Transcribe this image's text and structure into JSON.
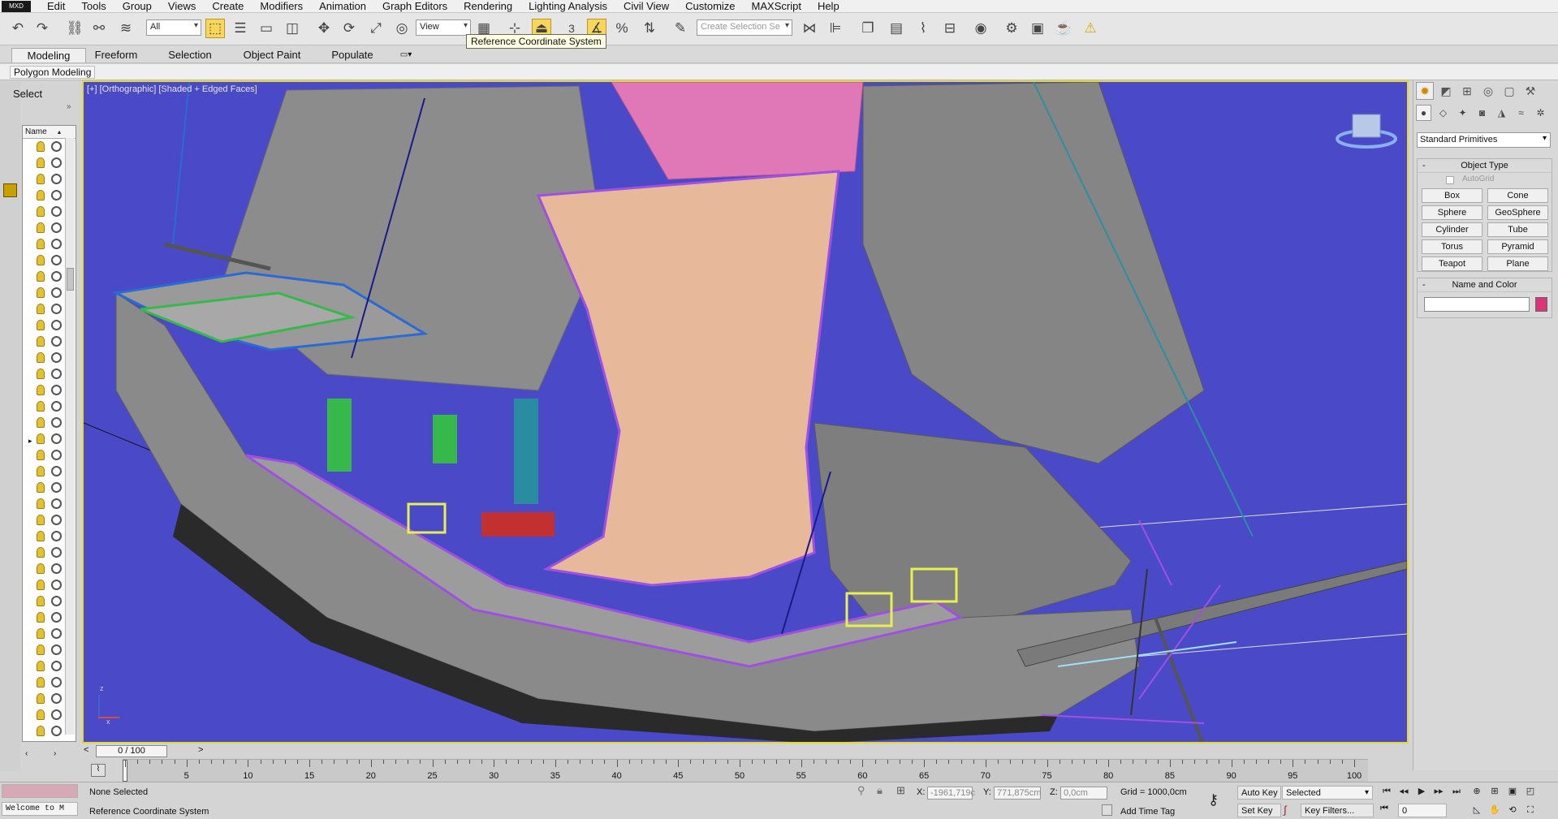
{
  "menu": [
    "Edit",
    "Tools",
    "Group",
    "Views",
    "Create",
    "Modifiers",
    "Animation",
    "Graph Editors",
    "Rendering",
    "Lighting Analysis",
    "Civil View",
    "Customize",
    "MAXScript",
    "Help"
  ],
  "app_logo": "MXD",
  "toolbar": {
    "selection_filter": "All",
    "ref_coord": "View",
    "named_selection_placeholder": "Create Selection Se",
    "snap_label": "3",
    "tooltip": "Reference Coordinate System"
  },
  "ribbon": {
    "tabs": [
      "Modeling",
      "Freeform",
      "Selection",
      "Object Paint",
      "Populate"
    ],
    "subtab": "Polygon Modeling"
  },
  "scene_explorer": {
    "select_label": "Select",
    "column_header": "Name"
  },
  "viewport": {
    "label": "[+] [Orthographic] [Shaded + Edged Faces]",
    "background_color": "#4a4ac8",
    "gizmo_axis_x": "x",
    "gizmo_axis_z": "z"
  },
  "command_panel": {
    "dropdown": "Standard Primitives",
    "object_type_title": "Object Type",
    "autogrid_label": "AutoGrid",
    "object_buttons": [
      "Box",
      "Cone",
      "Sphere",
      "GeoSphere",
      "Cylinder",
      "Tube",
      "Torus",
      "Pyramid",
      "Teapot",
      "Plane"
    ],
    "name_color_title": "Name and Color",
    "object_color": "#d9367a"
  },
  "timeline": {
    "frame_counter": "0 / 100",
    "ticks": [
      "0",
      "5",
      "10",
      "15",
      "20",
      "25",
      "30",
      "35",
      "40",
      "45",
      "50",
      "55",
      "60",
      "65",
      "70",
      "75",
      "80",
      "85",
      "90",
      "95",
      "100"
    ]
  },
  "status": {
    "selection": "None Selected",
    "prompt": "Reference Coordinate System",
    "welcome": "Welcome to M",
    "x_label": "X:",
    "x_value": "-1961,719c",
    "y_label": "Y:",
    "y_value": "771,875cm",
    "z_label": "Z:",
    "z_value": "0,0cm",
    "grid": "Grid = 1000,0cm",
    "add_time_tag": "Add Time Tag",
    "auto_key": "Auto Key",
    "set_key": "Set Key",
    "key_mode": "Selected",
    "key_filters": "Key Filters...",
    "current_frame": "0"
  }
}
